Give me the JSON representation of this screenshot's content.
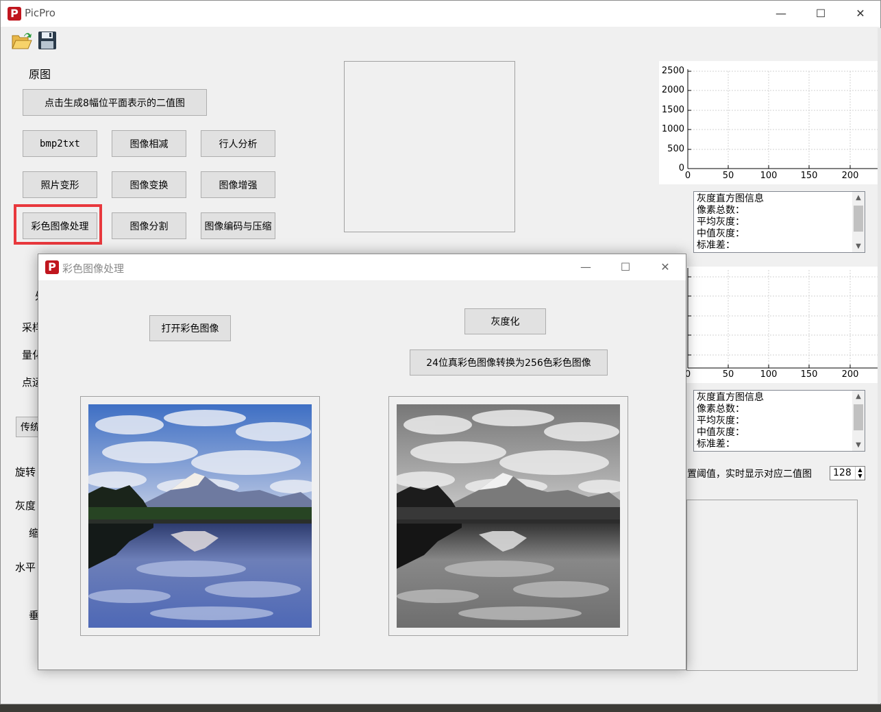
{
  "app": {
    "title": "PicPro",
    "logo_letter": "P",
    "controls": {
      "minimize": "—",
      "maximize": "☐",
      "close": "✕"
    }
  },
  "toolbar": {
    "open_icon": "open-folder-icon",
    "save_icon": "save-disk-icon"
  },
  "main": {
    "original_label": "原图",
    "bitplane_button": "点击生成8幅位平面表示的二值图",
    "buttons": {
      "bmp2txt": "bmp2txt",
      "subtract": "图像相减",
      "pedestrian": "行人分析",
      "warp": "照片变形",
      "transform": "图像变换",
      "enhance": "图像增强",
      "color_processing": "彩色图像处理",
      "segment": "图像分割",
      "codec": "图像编码与压缩"
    },
    "highlight_color": "#e8383d",
    "left_fragments": {
      "f0": "处",
      "f1": "采样",
      "f2": "量化",
      "f3": "点运",
      "f4": "传统",
      "f5": "旋转",
      "f6": "灰度",
      "f7": "缩",
      "f8": "水平",
      "f9": "垂"
    }
  },
  "histogram1": {
    "y_ticks": [
      "2500",
      "2000",
      "1500",
      "1000",
      "500",
      "0"
    ],
    "x_ticks": [
      "0",
      "50",
      "100",
      "150",
      "200"
    ],
    "info_lines": [
      "灰度直方图信息",
      "像素总数：",
      "平均灰度：",
      "中值灰度：",
      "标准差："
    ]
  },
  "histogram2": {
    "x_ticks": [
      "0",
      "50",
      "100",
      "150",
      "200"
    ],
    "info_lines": [
      "灰度直方图信息",
      "像素总数：",
      "平均灰度：",
      "中值灰度：",
      "标准差："
    ]
  },
  "threshold": {
    "label": "置阈值，实时显示对应二值图",
    "value": "128"
  },
  "dialog": {
    "title": "彩色图像处理",
    "open_button": "打开彩色图像",
    "gray_button": "灰度化",
    "convert_button": "24位真彩色图像转换为256色彩色图像"
  }
}
